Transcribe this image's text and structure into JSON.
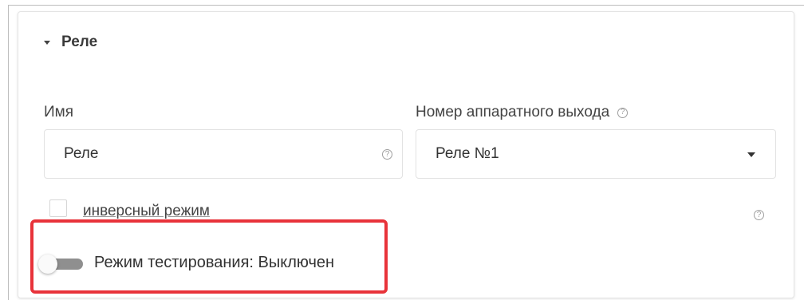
{
  "section": {
    "title": "Реле",
    "expanded": true
  },
  "name_field": {
    "label": "Имя",
    "value": "Реле",
    "help_icon": "?"
  },
  "output_field": {
    "label": "Номер аппаратного выхода",
    "help_icon": "?",
    "selected": "Реле №1"
  },
  "inverse_mode": {
    "label": "инверсный режим",
    "checked": false,
    "help_icon": "?"
  },
  "test_mode": {
    "label": "Режим тестирования: Выключен",
    "enabled": false
  },
  "colors": {
    "highlight": "#e8333a",
    "toggle_off": "#8f8f8f"
  }
}
